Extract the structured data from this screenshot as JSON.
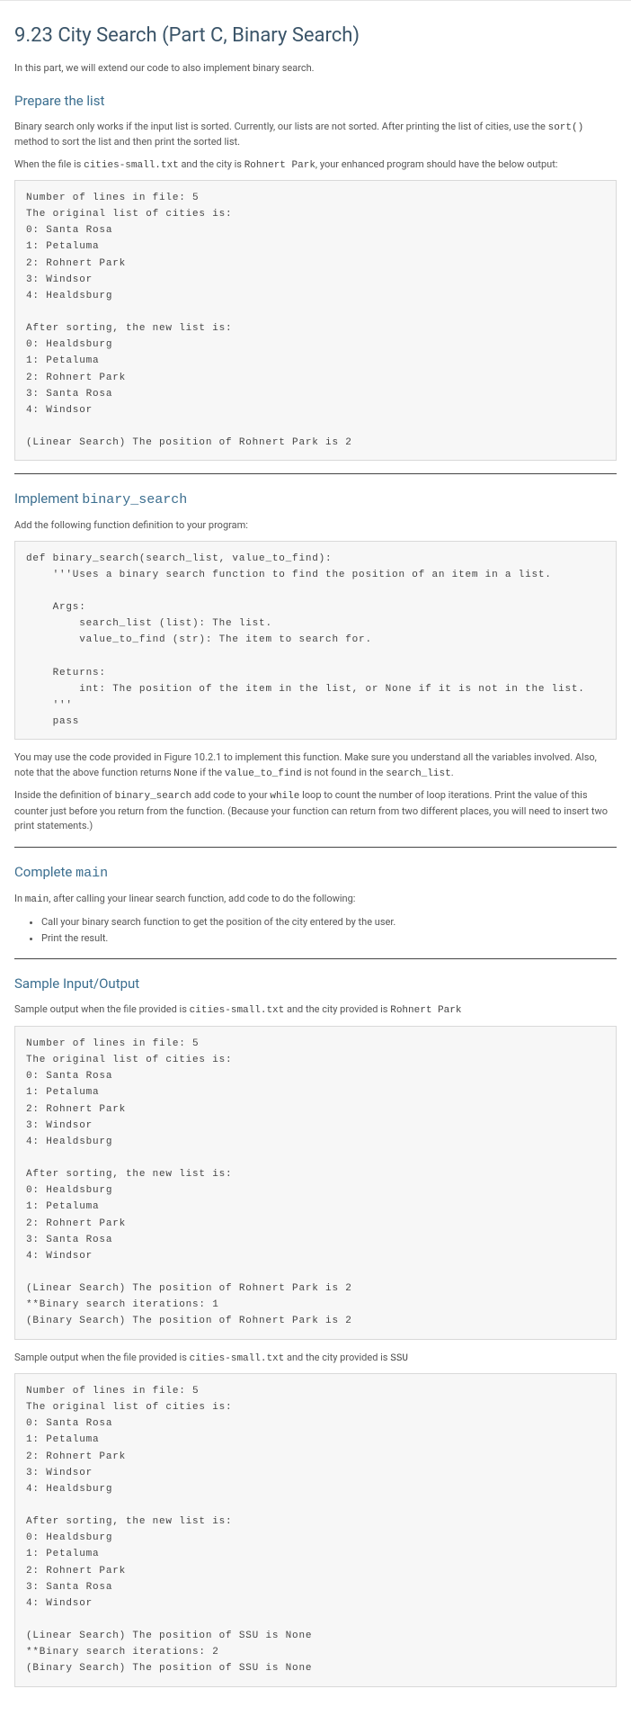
{
  "title": "9.23 City Search (Part C, Binary Search)",
  "intro": "In this part, we will extend our code to also implement binary search.",
  "sections": {
    "prepare": {
      "heading": "Prepare the list",
      "p1_a": "Binary search only works if the input list is sorted. Currently, our lists are not sorted. After printing the list of cities, use the ",
      "p1_code": "sort()",
      "p1_b": " method to sort the list and then print the sorted list.",
      "p2_a": "When the file is ",
      "p2_code1": "cities-small.txt",
      "p2_b": " and the city is ",
      "p2_code2": "Rohnert Park",
      "p2_c": ", your enhanced program should have the below output:",
      "output": "Number of lines in file: 5\nThe original list of cities is:\n0: Santa Rosa\n1: Petaluma\n2: Rohnert Park\n3: Windsor\n4: Healdsburg\n\nAfter sorting, the new list is:\n0: Healdsburg\n1: Petaluma\n2: Rohnert Park\n3: Santa Rosa\n4: Windsor\n\n(Linear Search) The position of Rohnert Park is 2"
    },
    "implement": {
      "heading_a": "Implement ",
      "heading_code": "binary_search",
      "p1": "Add the following function definition to your program:",
      "code": "def binary_search(search_list, value_to_find):\n    '''Uses a binary search function to find the position of an item in a list.\n\n    Args:\n        search_list (list): The list.\n        value_to_find (str): The item to search for.\n\n    Returns:\n        int: The position of the item in the list, or None if it is not in the list.\n    '''\n    pass",
      "p2_a": "You may use the code provided in Figure 10.2.1 to implement this function. Make sure you understand all the variables involved. Also, note that the above function returns ",
      "p2_code1": "None",
      "p2_b": " if the ",
      "p2_code2": "value_to_find",
      "p2_c": " is not found in the ",
      "p2_code3": "search_list",
      "p2_d": ".",
      "p3_a": "Inside the definition of ",
      "p3_code": "binary_search",
      "p3_b": " add code to your ",
      "p3_code2": "while",
      "p3_c": " loop to count the number of loop iterations. Print the value of this counter just before you return from the function. (Because your function can return from two different places, you will need to insert two print statements.)"
    },
    "complete": {
      "heading_a": "Complete ",
      "heading_code": "main",
      "p1_a": "In ",
      "p1_code": "main",
      "p1_b": ", after calling your linear search function, add code to do the following:",
      "li1": "Call your binary search function to get the position of the city entered by the user.",
      "li2": "Print the result."
    },
    "sample": {
      "heading": "Sample Input/Output",
      "p1_a": "Sample output when the file provided is ",
      "p1_code1": "cities-small.txt",
      "p1_b": " and the city provided is ",
      "p1_code2": "Rohnert Park",
      "output1": "Number of lines in file: 5\nThe original list of cities is:\n0: Santa Rosa\n1: Petaluma\n2: Rohnert Park\n3: Windsor\n4: Healdsburg\n\nAfter sorting, the new list is:\n0: Healdsburg\n1: Petaluma\n2: Rohnert Park\n3: Santa Rosa\n4: Windsor\n\n(Linear Search) The position of Rohnert Park is 2\n**Binary search iterations: 1\n(Binary Search) The position of Rohnert Park is 2",
      "p2_a": "Sample output when the file provided is ",
      "p2_code1": "cities-small.txt",
      "p2_b": " and the city provided is ",
      "p2_code2": "SSU",
      "output2": "Number of lines in file: 5\nThe original list of cities is:\n0: Santa Rosa\n1: Petaluma\n2: Rohnert Park\n3: Windsor\n4: Healdsburg\n\nAfter sorting, the new list is:\n0: Healdsburg\n1: Petaluma\n2: Rohnert Park\n3: Santa Rosa\n4: Windsor\n\n(Linear Search) The position of SSU is None\n**Binary search iterations: 2\n(Binary Search) The position of SSU is None"
    }
  }
}
